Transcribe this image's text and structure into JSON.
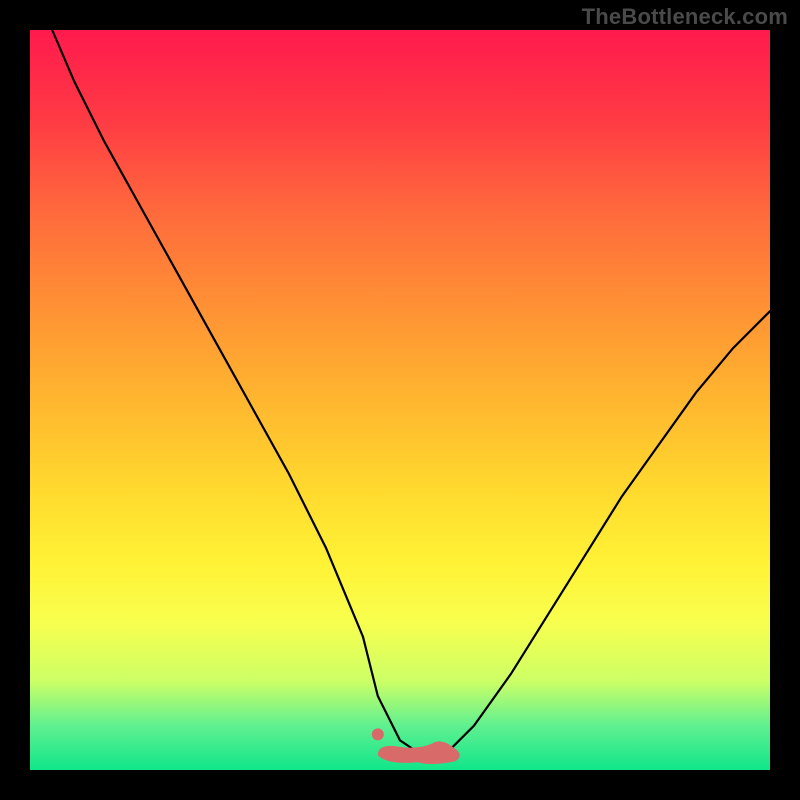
{
  "watermark": "TheBottleneck.com",
  "colors": {
    "frame": "#000000",
    "curve": "#000000",
    "marker": "#d86a6a",
    "gradient_stops": [
      "#ff1a4d",
      "#ff3a44",
      "#ff6b3c",
      "#ff9334",
      "#ffb62f",
      "#ffd92e",
      "#fff235",
      "#f8ff4e",
      "#ccff66",
      "#60f090",
      "#10e68a"
    ]
  },
  "chart_data": {
    "type": "line",
    "title": "",
    "xlabel": "",
    "ylabel": "",
    "xlim": [
      0,
      100
    ],
    "ylim": [
      0,
      100
    ],
    "grid": false,
    "legend": false,
    "series": [
      {
        "name": "bottleneck-curve",
        "x": [
          3,
          6,
          10,
          15,
          20,
          25,
          30,
          35,
          40,
          45,
          47,
          50,
          53,
          55,
          57,
          60,
          65,
          70,
          75,
          80,
          85,
          90,
          95,
          100
        ],
        "y": [
          100,
          93,
          85,
          76,
          67,
          58,
          49,
          40,
          30,
          18,
          10,
          4,
          2,
          2,
          3,
          6,
          13,
          21,
          29,
          37,
          44,
          51,
          57,
          62
        ]
      }
    ],
    "annotations": [
      {
        "name": "flat-minimum-marker",
        "x_range": [
          47,
          58
        ],
        "y": 2
      },
      {
        "name": "minimum-dot",
        "x": 47,
        "y": 4
      }
    ]
  }
}
